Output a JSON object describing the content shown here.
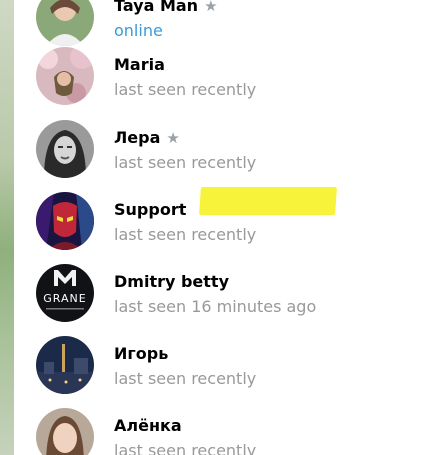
{
  "contacts": [
    {
      "name": "Taya Man",
      "starred": true,
      "status": "online",
      "online": true
    },
    {
      "name": "Maria",
      "starred": false,
      "status": "last seen recently",
      "online": false
    },
    {
      "name": "Лера",
      "starred": true,
      "status": "last seen recently",
      "online": false
    },
    {
      "name": "Support",
      "starred": false,
      "status": "last seen recently",
      "online": false,
      "highlighted": true
    },
    {
      "name": "Dmitry betty",
      "starred": false,
      "status": "last seen 16 minutes ago",
      "online": false
    },
    {
      "name": "Игорь",
      "starred": false,
      "status": "last seen recently",
      "online": false
    },
    {
      "name": "Алёнка",
      "starred": false,
      "status": "last seen recently",
      "online": false
    }
  ],
  "icons": {
    "star": "star-icon"
  },
  "colors": {
    "online": "#3a9bd8",
    "status": "#999999",
    "highlight": "#f7f33a",
    "star": "#9aa2a8"
  },
  "avatar_text": {
    "dmitry_logo": "GRANE"
  }
}
